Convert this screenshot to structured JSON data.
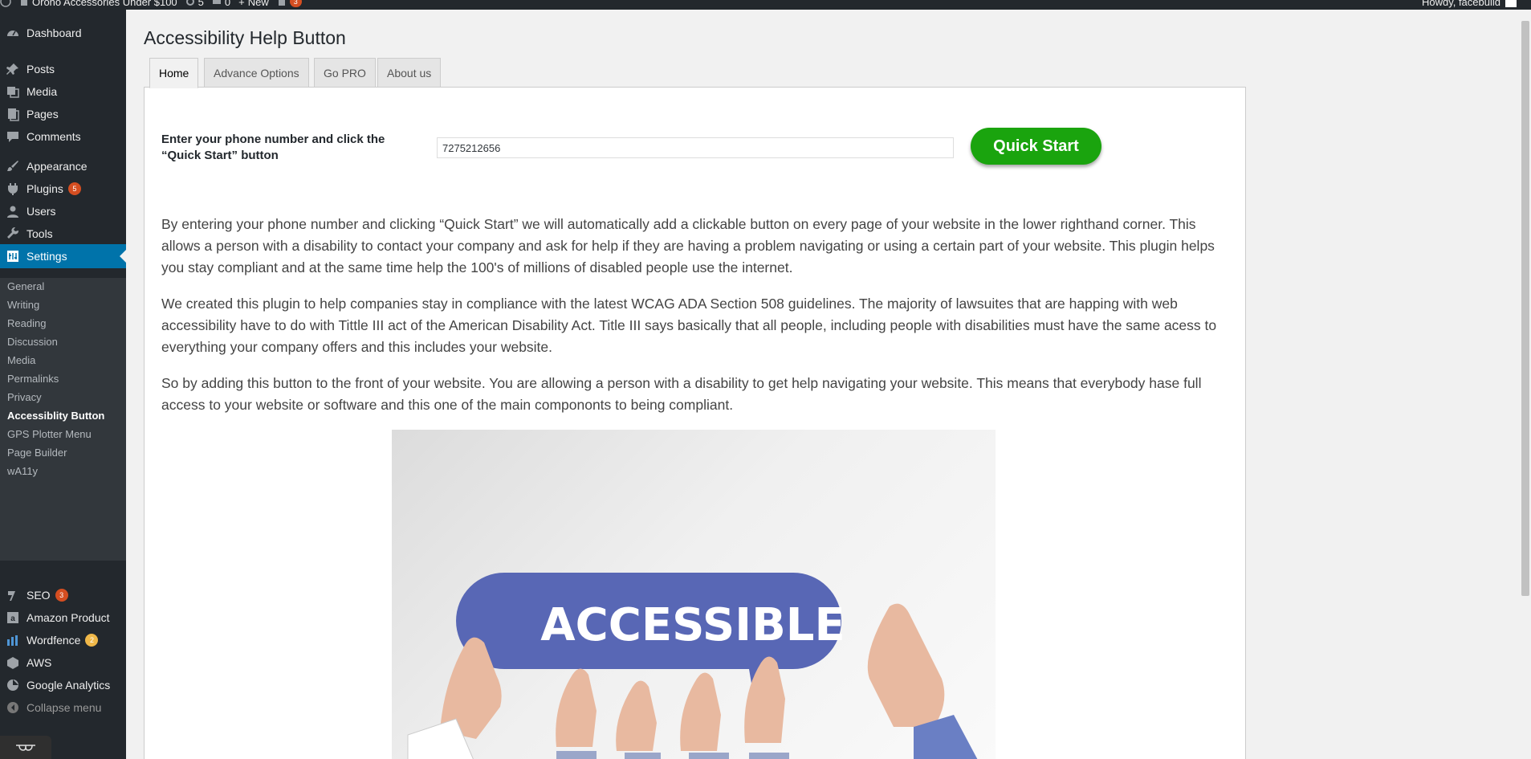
{
  "adminbar": {
    "site_title": "Orono Accessories Under $100",
    "updates_count": "5",
    "comments_count": "0",
    "new_label": "New",
    "notifications_count": "3",
    "howdy": "Howdy, facebuild"
  },
  "sidebar": {
    "items": [
      {
        "label": "Dashboard",
        "icon": "dashboard-icon"
      },
      {
        "label": "Posts",
        "icon": "pin-icon"
      },
      {
        "label": "Media",
        "icon": "media-icon"
      },
      {
        "label": "Pages",
        "icon": "pages-icon"
      },
      {
        "label": "Comments",
        "icon": "comment-icon"
      },
      {
        "label": "Appearance",
        "icon": "brush-icon"
      },
      {
        "label": "Plugins",
        "icon": "plug-icon",
        "count": "5"
      },
      {
        "label": "Users",
        "icon": "user-icon"
      },
      {
        "label": "Tools",
        "icon": "wrench-icon"
      },
      {
        "label": "Settings",
        "icon": "settings-icon"
      }
    ],
    "submenu": [
      {
        "label": "General"
      },
      {
        "label": "Writing"
      },
      {
        "label": "Reading"
      },
      {
        "label": "Discussion"
      },
      {
        "label": "Media"
      },
      {
        "label": "Permalinks"
      },
      {
        "label": "Privacy"
      },
      {
        "label": "Accessiblity Button"
      },
      {
        "label": "GPS Plotter Menu"
      },
      {
        "label": "Page Builder"
      },
      {
        "label": "wA11y"
      }
    ],
    "lower_items": [
      {
        "label": "SEO",
        "icon": "seo-icon",
        "count": "3"
      },
      {
        "label": "Amazon Product",
        "icon": "amazon-icon"
      },
      {
        "label": "Wordfence",
        "icon": "wordfence-icon",
        "count": "2"
      },
      {
        "label": "AWS",
        "icon": "aws-icon"
      },
      {
        "label": "Google Analytics",
        "icon": "analytics-icon"
      }
    ],
    "collapse_label": "Collapse menu"
  },
  "page": {
    "title": "Accessibility Help Button",
    "tabs": [
      {
        "label": "Home"
      },
      {
        "label": "Advance Options"
      },
      {
        "label": "Go PRO"
      },
      {
        "label": "About us"
      }
    ],
    "phone_label": "Enter your phone number and click the “Quick Start” button",
    "phone_value": "7275212656",
    "quick_start_label": "Quick Start",
    "paragraphs": [
      "By entering your phone number and clicking “Quick Start” we will automatically add a clickable button on every page of your website in the lower righthand corner. This allows a person with a disability to contact your company and ask for help if they are having a problem navigating or using a certain part of your website. This plugin helps you stay compliant and at the same time help the 100's of millions of disabled people use the internet.",
      "We created this plugin to help companies stay in compliance with the latest WCAG ADA Section 508 guidelines. The majority of lawsuites that are happing with web accessibility have to do with Tittle III act of the American Disability Act. Title III says basically that all people, including people with disabilities must have the same acess to everything your company offers and this includes your website.",
      "So by adding this button to the front of your website. You are allowing a person with a disability to get help navigating your website. This means that everybody hase full access to your website or software and this one of the main compononts to being compliant."
    ],
    "hero_sign_text": "ACCESSIBLE"
  },
  "colors": {
    "sidebar_bg": "#23282d",
    "submenu_bg": "#32373c",
    "current_item": "#0073aa",
    "quick_start_green": "#1aa40e",
    "sign_blue": "#5867b5"
  }
}
